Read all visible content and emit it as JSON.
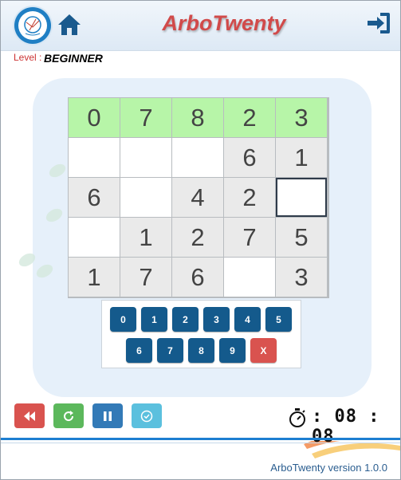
{
  "header": {
    "title": "ArboTwenty",
    "logo_icon": "arbotwenty-logo-icon",
    "home_icon": "home-icon",
    "logout_icon": "logout-icon"
  },
  "level": {
    "label": "Level :",
    "value": "BEGINNER"
  },
  "grid": {
    "rows": [
      [
        "0",
        "7",
        "8",
        "2",
        "3"
      ],
      [
        "",
        "",
        "",
        "6",
        "1"
      ],
      [
        "6",
        "",
        "4",
        "2",
        ""
      ],
      [
        "",
        "1",
        "2",
        "7",
        "5"
      ],
      [
        "1",
        "7",
        "6",
        "",
        "3"
      ]
    ],
    "given_row": 0,
    "selected_cell": {
      "row": 2,
      "col": 4
    },
    "colors": {
      "given": "#b7f5a8",
      "filled": "#eaeaea",
      "blank": "#ffffff"
    }
  },
  "keypad": {
    "row1": [
      "0",
      "1",
      "2",
      "3",
      "4",
      "5"
    ],
    "row2": [
      "6",
      "7",
      "8",
      "9"
    ],
    "clear_label": "X",
    "key_color": "#145a8c",
    "clear_color": "#d9534f"
  },
  "controls": {
    "rewind_icon": "rewind-icon",
    "restart_icon": "restart-icon",
    "pause_icon": "pause-icon",
    "check_icon": "check-circle-icon"
  },
  "timer": {
    "icon": "stopwatch-icon",
    "text": ": 08 : 08"
  },
  "footer": {
    "version": "ArboTwenty version 1.0.0"
  }
}
